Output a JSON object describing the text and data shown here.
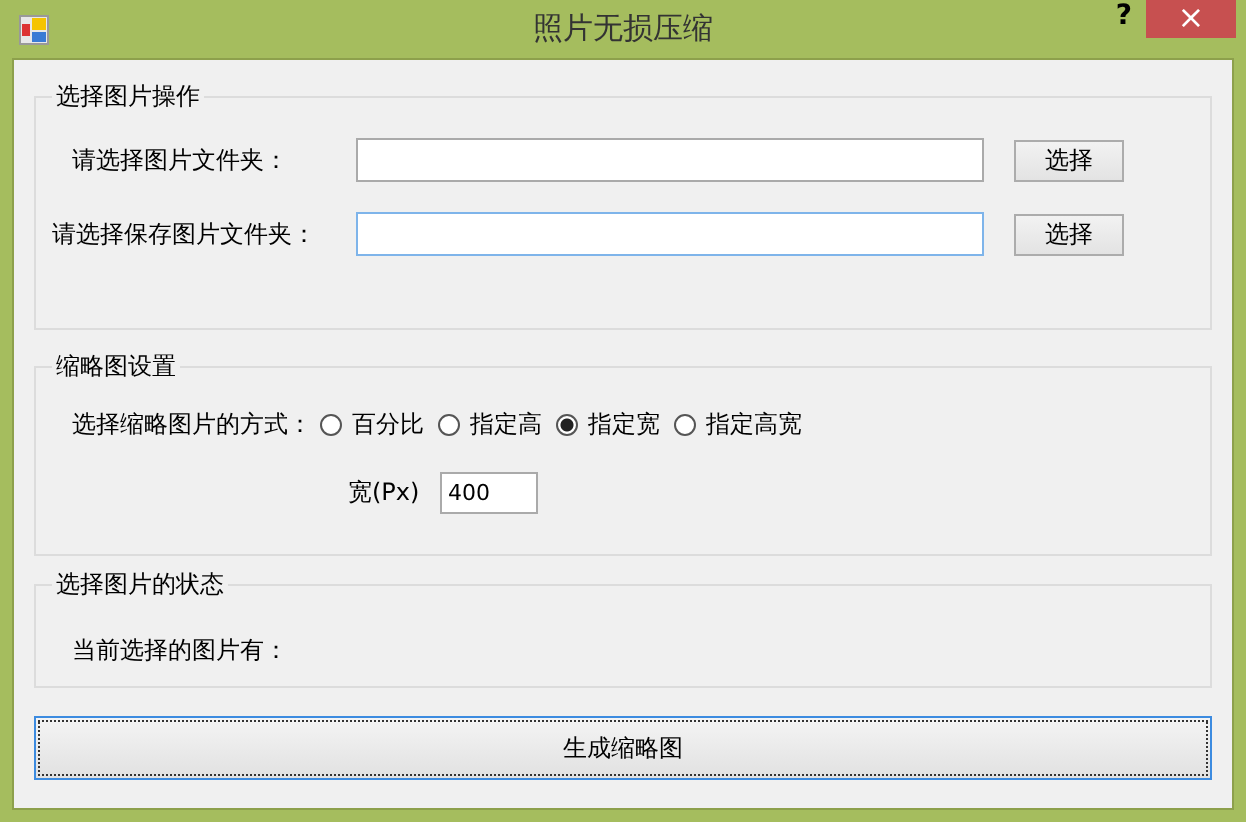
{
  "window": {
    "title": "照片无损压缩",
    "help": "?",
    "close": "×"
  },
  "file_group": {
    "title": "选择图片操作",
    "rows": [
      {
        "label": "请选择图片文件夹：",
        "focused": false,
        "button": "选择"
      },
      {
        "label": "请选择保存图片文件夹：",
        "focused": true,
        "button": "选择"
      }
    ]
  },
  "thumb_group": {
    "title": "缩略图设置",
    "mode_label": "选择缩略图片的方式：",
    "modes": [
      {
        "label": "百分比",
        "selected": false
      },
      {
        "label": "指定高",
        "selected": false
      },
      {
        "label": "指定宽",
        "selected": true
      },
      {
        "label": "指定高宽",
        "selected": false
      }
    ],
    "width_label": "宽(Px)",
    "width_value": "400"
  },
  "status_group": {
    "title": "选择图片的状态",
    "label": "当前选择的图片有："
  },
  "generate_button": "生成缩略图"
}
